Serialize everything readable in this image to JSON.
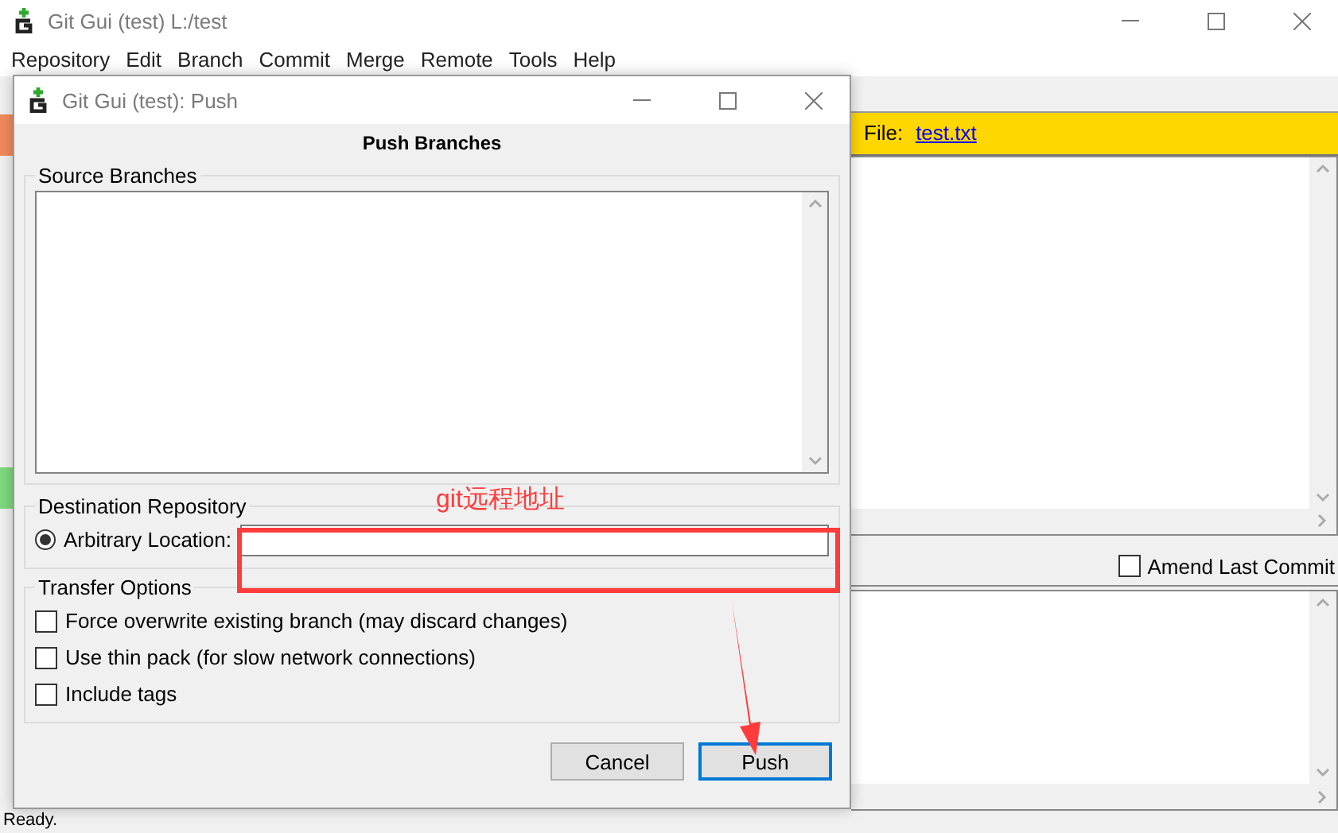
{
  "main_window": {
    "title": "Git Gui (test) L:/test",
    "menu": [
      "Repository",
      "Edit",
      "Branch",
      "Commit",
      "Merge",
      "Remote",
      "Tools",
      "Help"
    ],
    "diff_header": {
      "label": "File:",
      "file": "test.txt"
    },
    "amend": {
      "label": "Amend Last Commit",
      "checked": false
    },
    "status_bar": "Ready."
  },
  "dialog": {
    "title": "Git Gui (test): Push",
    "heading": "Push Branches",
    "source_branches": {
      "label": "Source Branches"
    },
    "destination": {
      "label": "Destination Repository",
      "option": {
        "label": "Arbitrary Location:",
        "selected": true
      }
    },
    "transfer_options": {
      "label": "Transfer Options",
      "options": [
        {
          "label": "Force overwrite existing branch (may discard changes)",
          "checked": false
        },
        {
          "label": "Use thin pack (for slow network connections)",
          "checked": false
        },
        {
          "label": "Include tags",
          "checked": false
        }
      ]
    },
    "buttons": [
      {
        "label": "Cancel",
        "default": false
      },
      {
        "label": "Push",
        "default": true
      }
    ]
  },
  "annotation": {
    "text": "git远程地址"
  }
}
